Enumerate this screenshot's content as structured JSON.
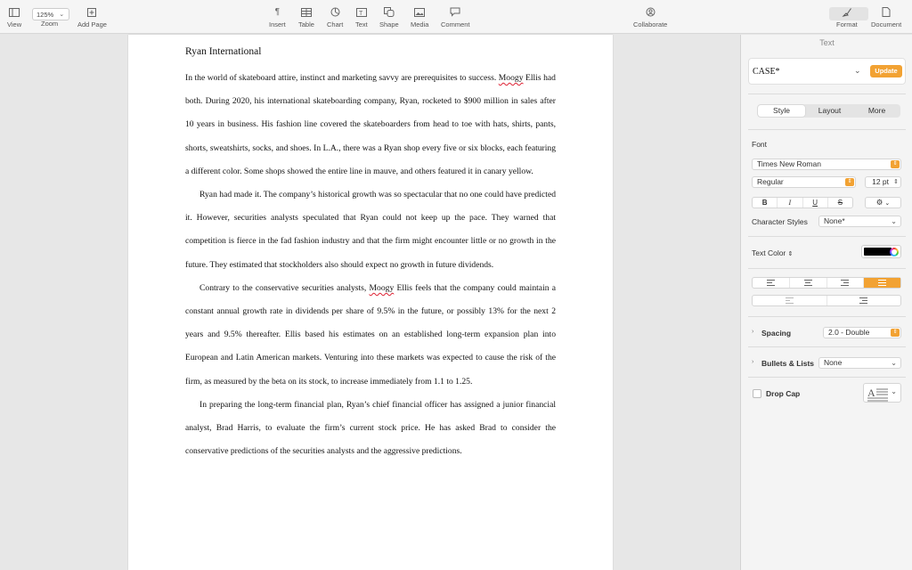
{
  "toolbar": {
    "view": "View",
    "zoom": "Zoom",
    "zoom_value": "125%",
    "add_page": "Add Page",
    "insert": "Insert",
    "table": "Table",
    "chart": "Chart",
    "text": "Text",
    "shape": "Shape",
    "media": "Media",
    "comment": "Comment",
    "collaborate": "Collaborate",
    "format": "Format",
    "document": "Document"
  },
  "document": {
    "title": "Ryan International",
    "p1_a": "In the world of skateboard attire, instinct and marketing savvy are prerequisites to success. ",
    "p1_name": "Moogy",
    "p1_b": " Ellis had both. During 2020, his international skateboarding company, Ryan, rocketed to $900 million in sales after 10 years in business. His fashion line covered the skateboarders from head to toe with hats, shirts, pants, shorts, sweatshirts, socks, and shoes. In L.A., there was a Ryan shop every five or six blocks, each featuring a different color. Some shops showed the entire line in mauve, and others featured it in canary yellow.",
    "p2": "Ryan had made it. The company’s historical growth was so spectacular that no one could have predicted it. However, securities analysts speculated that Ryan could not keep up the pace. They warned that competition is fierce in the fad fashion industry and that the firm might encounter little or no growth in the future. They estimated that stockholders also should expect no growth in future dividends.",
    "p3_a": "Contrary to the conservative securities analysts, ",
    "p3_name": "Moogy",
    "p3_b": " Ellis feels that the company could maintain a constant annual growth rate in dividends per share of 9.5% in the future, or possibly 13% for the next 2 years and 9.5% thereafter. Ellis based his estimates on an established long-term expansion plan into European and Latin American markets. Venturing into these markets was expected to cause the risk of the firm, as measured by the beta on its stock, to increase immediately from 1.1 to 1.25.",
    "p4": "In preparing the long-term financial plan, Ryan’s chief financial officer has assigned a junior financial analyst, Brad Harris, to evaluate the firm’s current stock price. He has asked Brad to consider the conservative predictions of the securities analysts and the aggressive predictions."
  },
  "sidebar": {
    "title": "Text",
    "paragraph_style": "CASE*",
    "update": "Update",
    "tabs": [
      "Style",
      "Layout",
      "More"
    ],
    "font_label": "Font",
    "font_family": "Times New Roman",
    "font_weight": "Regular",
    "font_size": "12 pt",
    "bold": "B",
    "italic": "I",
    "underline": "U",
    "strike": "S",
    "char_styles_label": "Character Styles",
    "char_styles_value": "None*",
    "text_color_label": "Text Color",
    "text_color": "#000000",
    "accent": "#f2a233",
    "spacing_label": "Spacing",
    "spacing_value": "2.0 - Double",
    "bullets_label": "Bullets & Lists",
    "bullets_value": "None",
    "dropcap_label": "Drop Cap"
  }
}
